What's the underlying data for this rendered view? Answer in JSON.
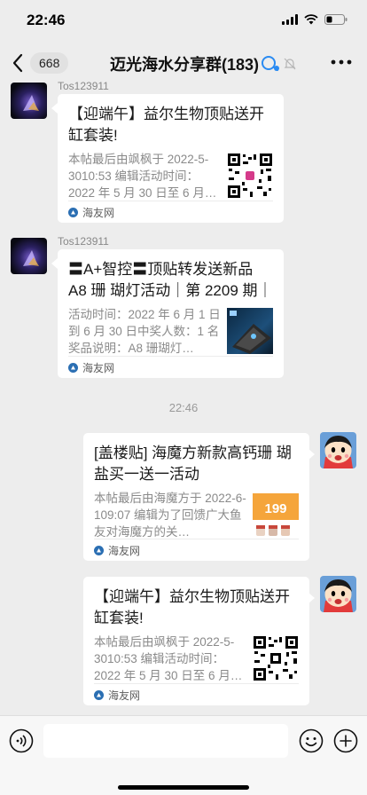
{
  "status_bar": {
    "time": "22:46"
  },
  "nav": {
    "unread_count": "668",
    "title": "迈光海水分享群(183)"
  },
  "messages": [
    {
      "sender": "Tos123911",
      "title": "【迎端午】益尔生物顶贴送开缸套装!",
      "desc": "本帖最后由飒枫于 2022-5-3010:53 编辑活动时间：2022 年 5 月 30 日至 6 月…",
      "source": "海友网"
    },
    {
      "sender": "Tos123911",
      "title": "〓A+智控〓顶贴转发送新品 A8 珊 瑚灯活动｜第 2209 期｜",
      "desc": "活动时间：2022 年 6 月 1 日到 6 月 30 日中奖人数：1 名奖品说明：A8 珊瑚灯…",
      "source": "海友网"
    },
    {
      "title": "[盖楼贴] 海魔方新款高钙珊 瑚盐买一送一活动",
      "desc": "本帖最后由海魔方于 2022-6-109:07 编辑为了回馈广大鱼友对海魔方的关…",
      "source": "海友网"
    },
    {
      "title": "【迎端午】益尔生物顶贴送开缸套装!",
      "desc": "本帖最后由飒枫于 2022-5-3010:53 编辑活动时间：2022 年 5 月 30 日至 6 月…",
      "source": "海友网"
    }
  ],
  "time_divider": "22:46",
  "thumb_text": {
    "promo": "199"
  },
  "colors": {
    "background": "#ededed",
    "card": "#ffffff",
    "accent_blue": "#2a8bf2"
  }
}
